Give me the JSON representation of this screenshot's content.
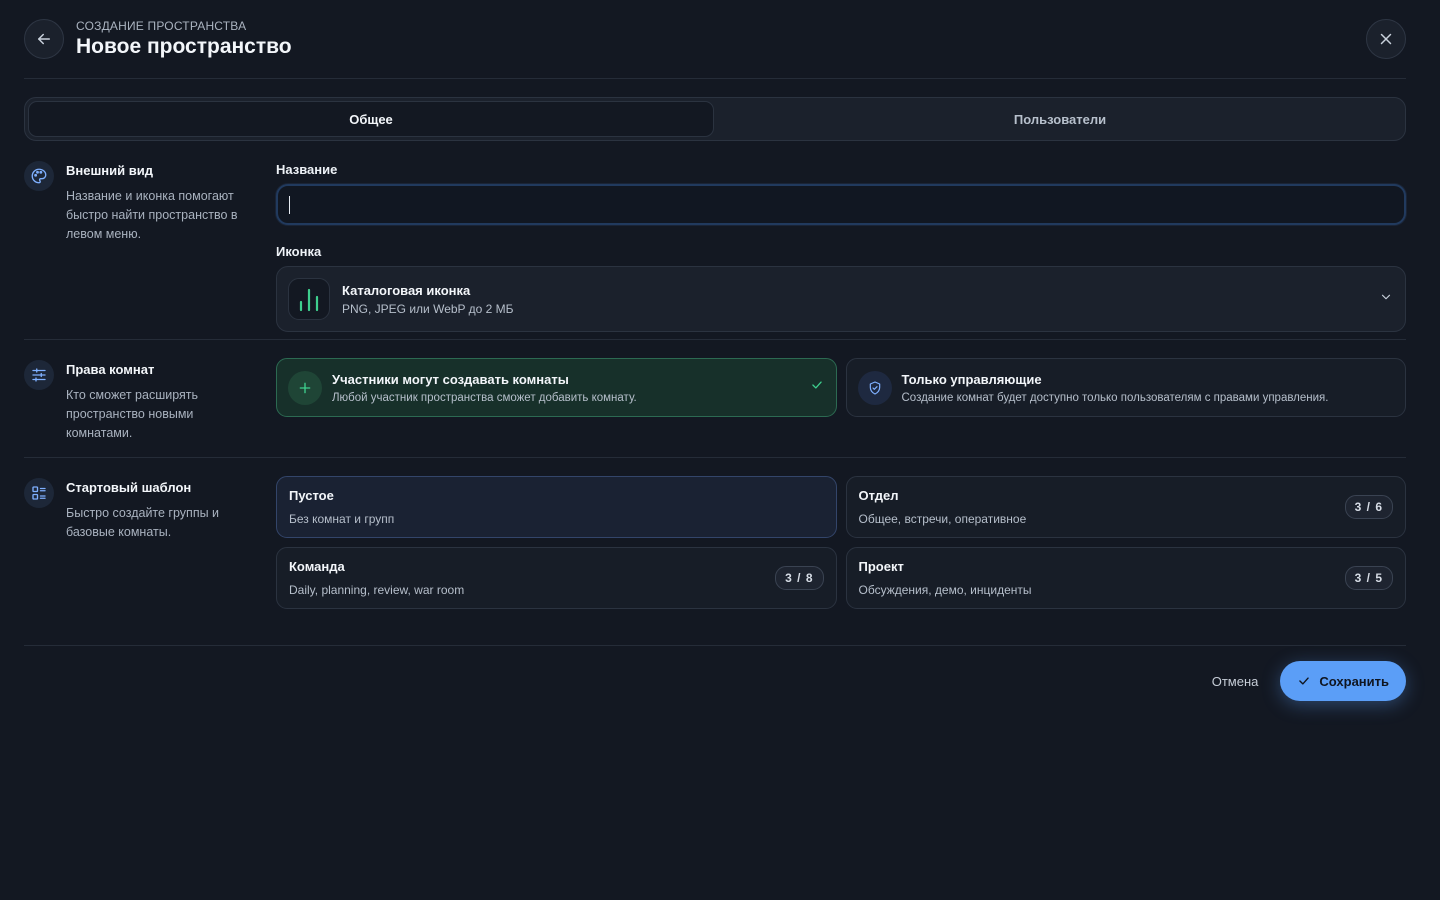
{
  "header": {
    "eyebrow": "СОЗДАНИЕ ПРОСТРАНСТВА",
    "title": "Новое пространство",
    "back_icon": "arrow-left-icon",
    "close_icon": "close-icon"
  },
  "tabs": [
    {
      "label": "Общее",
      "active": true
    },
    {
      "label": "Пользователи",
      "active": false
    }
  ],
  "appearance": {
    "title": "Внешний вид",
    "description": "Название и иконка помогают быстро найти пространство в левом меню.",
    "name_label": "Название",
    "name_value": "",
    "icon_label": "Иконка",
    "icon_title": "Каталоговая иконка",
    "icon_sub": "PNG, JPEG или WebP до 2 МБ"
  },
  "rights": {
    "title": "Права комнат",
    "description": "Кто сможет расширять пространство новыми комнатами.",
    "options": [
      {
        "title": "Участники могут создавать комнаты",
        "desc": "Любой участник пространства сможет добавить комнату.",
        "selected": true
      },
      {
        "title": "Только управляющие",
        "desc": "Создание комнат будет доступно только пользователям с правами управления.",
        "selected": false
      }
    ]
  },
  "template": {
    "title": "Стартовый шаблон",
    "description": "Быстро создайте группы и базовые комнаты.",
    "items": [
      {
        "title": "Пустое",
        "desc": "Без комнат и групп",
        "badge": "",
        "selected": true
      },
      {
        "title": "Отдел",
        "desc": "Общее, встречи, оперативное",
        "badge": "3 / 6",
        "selected": false
      },
      {
        "title": "Команда",
        "desc": "Daily, planning, review, war room",
        "badge": "3 / 8",
        "selected": false
      },
      {
        "title": "Проект",
        "desc": "Обсуждения, демо, инциденты",
        "badge": "3 / 5",
        "selected": false
      }
    ]
  },
  "footer": {
    "cancel": "Отмена",
    "save": "Сохранить"
  },
  "colors": {
    "background": "#131822",
    "accent": "#5b9ef7",
    "success": "#3ecf8e"
  }
}
